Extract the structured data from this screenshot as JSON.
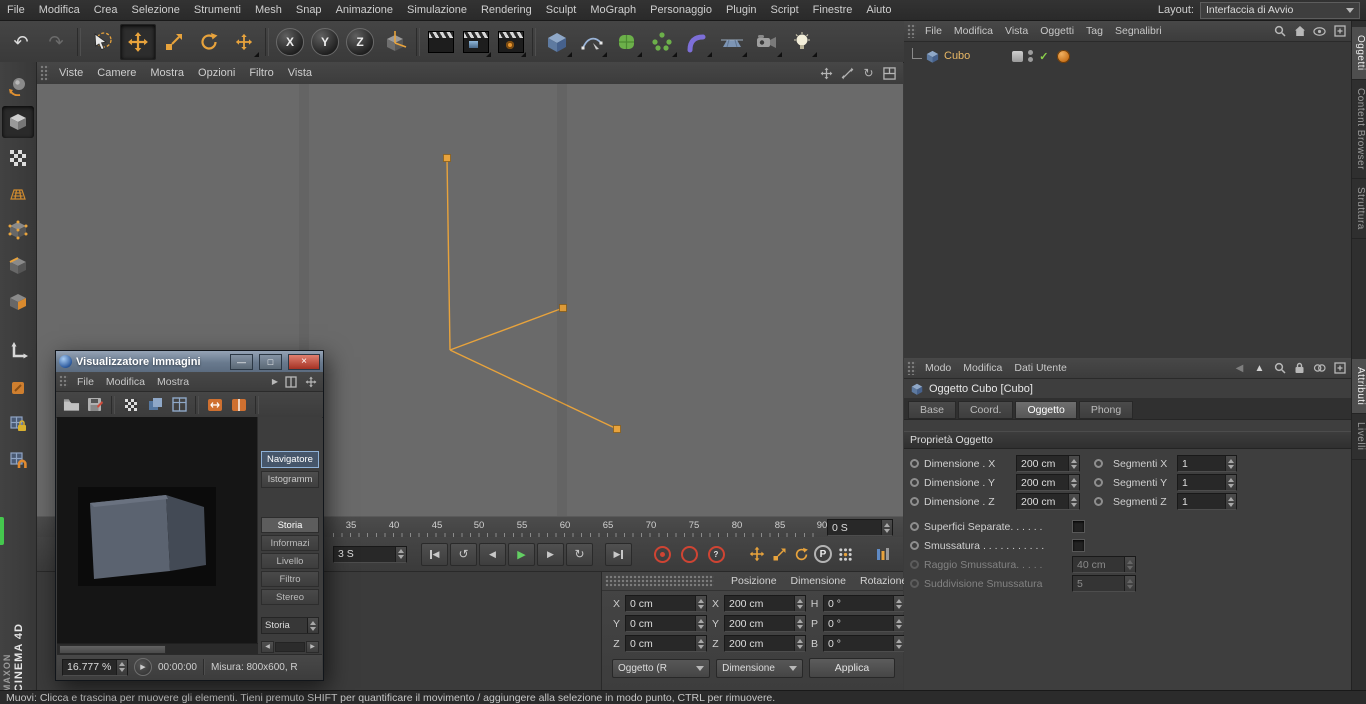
{
  "menubar": {
    "items": [
      "File",
      "Modifica",
      "Crea",
      "Selezione",
      "Strumenti",
      "Mesh",
      "Snap",
      "Animazione",
      "Simulazione",
      "Rendering",
      "Sculpt",
      "MoGraph",
      "Personaggio",
      "Plugin",
      "Script",
      "Finestre",
      "Aiuto"
    ],
    "layout_label": "Layout:",
    "layout_value": "Interfaccia di Avvio"
  },
  "toolbar": {
    "axis_x": "X",
    "axis_y": "Y",
    "axis_z": "Z"
  },
  "viewport": {
    "menu": [
      "Viste",
      "Camere",
      "Mostra",
      "Opzioni",
      "Filtro",
      "Vista"
    ],
    "accent": "#e8a33c"
  },
  "timeline": {
    "ticks": [
      "35",
      "40",
      "45",
      "50",
      "55",
      "60",
      "65",
      "70",
      "75",
      "80",
      "85",
      "90"
    ],
    "range_end": "0 S",
    "current_frame": "3 S",
    "p_label": "P"
  },
  "coords": {
    "grp_position": "Posizione",
    "grp_size": "Dimensione",
    "grp_rotation": "Rotazione",
    "px_label": "X",
    "px": "0 cm",
    "py_label": "Y",
    "py": "0 cm",
    "pz_label": "Z",
    "pz": "0 cm",
    "sx_label": "X",
    "sx": "200 cm",
    "sy_label": "Y",
    "sy": "200 cm",
    "sz_label": "Z",
    "sz": "200 cm",
    "rh_label": "H",
    "rh": "0 °",
    "rp_label": "P",
    "rp": "0 °",
    "rb_label": "B",
    "rb": "0 °",
    "mode_dropdown": "Oggetto (R",
    "size_dropdown": "Dimensione",
    "apply": "Applica"
  },
  "object_manager": {
    "menus": [
      "File",
      "Modifica",
      "Vista",
      "Oggetti",
      "Tag",
      "Segnalibri"
    ],
    "object_name": "Cubo"
  },
  "right_tabs": {
    "top": [
      "Oggetti",
      "Content Browser",
      "Struttura"
    ],
    "bottom": [
      "Attributi",
      "Livelli"
    ]
  },
  "attributes": {
    "menus": [
      "Modo",
      "Modifica",
      "Dati Utente"
    ],
    "title": "Oggetto Cubo [Cubo]",
    "tabs": [
      "Base",
      "Coord.",
      "Oggetto",
      "Phong"
    ],
    "section": "Proprietà Oggetto",
    "rows": [
      {
        "label": "Dimensione . X",
        "value": "200 cm",
        "label2": "Segmenti X",
        "value2": "1"
      },
      {
        "label": "Dimensione . Y",
        "value": "200 cm",
        "label2": "Segmenti Y",
        "value2": "1"
      },
      {
        "label": "Dimensione . Z",
        "value": "200 cm",
        "label2": "Segmenti Z",
        "value2": "1"
      }
    ],
    "check_rows": [
      {
        "label": "Superfici Separate. . . . . ."
      },
      {
        "label": "Smussatura . . . . . . . . . . ."
      }
    ],
    "disabled_rows": [
      {
        "label": "Raggio Smussatura. . . . .",
        "value": "40 cm"
      },
      {
        "label": "Suddivisione Smussatura",
        "value": "5"
      }
    ]
  },
  "image_viewer": {
    "title": "Visualizzatore Immagini",
    "menus": [
      "File",
      "Modifica",
      "Mostra"
    ],
    "nav_button": "Navigatore",
    "histogram_button": "Istogramm",
    "tabs": [
      "Storia",
      "Informazi",
      "Livello",
      "Filtro",
      "Stereo"
    ],
    "dropdown_value": "Storia",
    "zoom_value": "16.777 %",
    "time_value": "00:00:00",
    "status_text": "Misura: 800x600, R"
  },
  "branding": {
    "company": "MAXON",
    "product": "CINEMA 4D"
  },
  "statusbar": {
    "text": "Muovi: Clicca e trascina per muovere gli elementi. Tieni premuto SHIFT per quantificare il movimento / aggiungere alla selezione in modo punto, CTRL per rimuovere."
  }
}
